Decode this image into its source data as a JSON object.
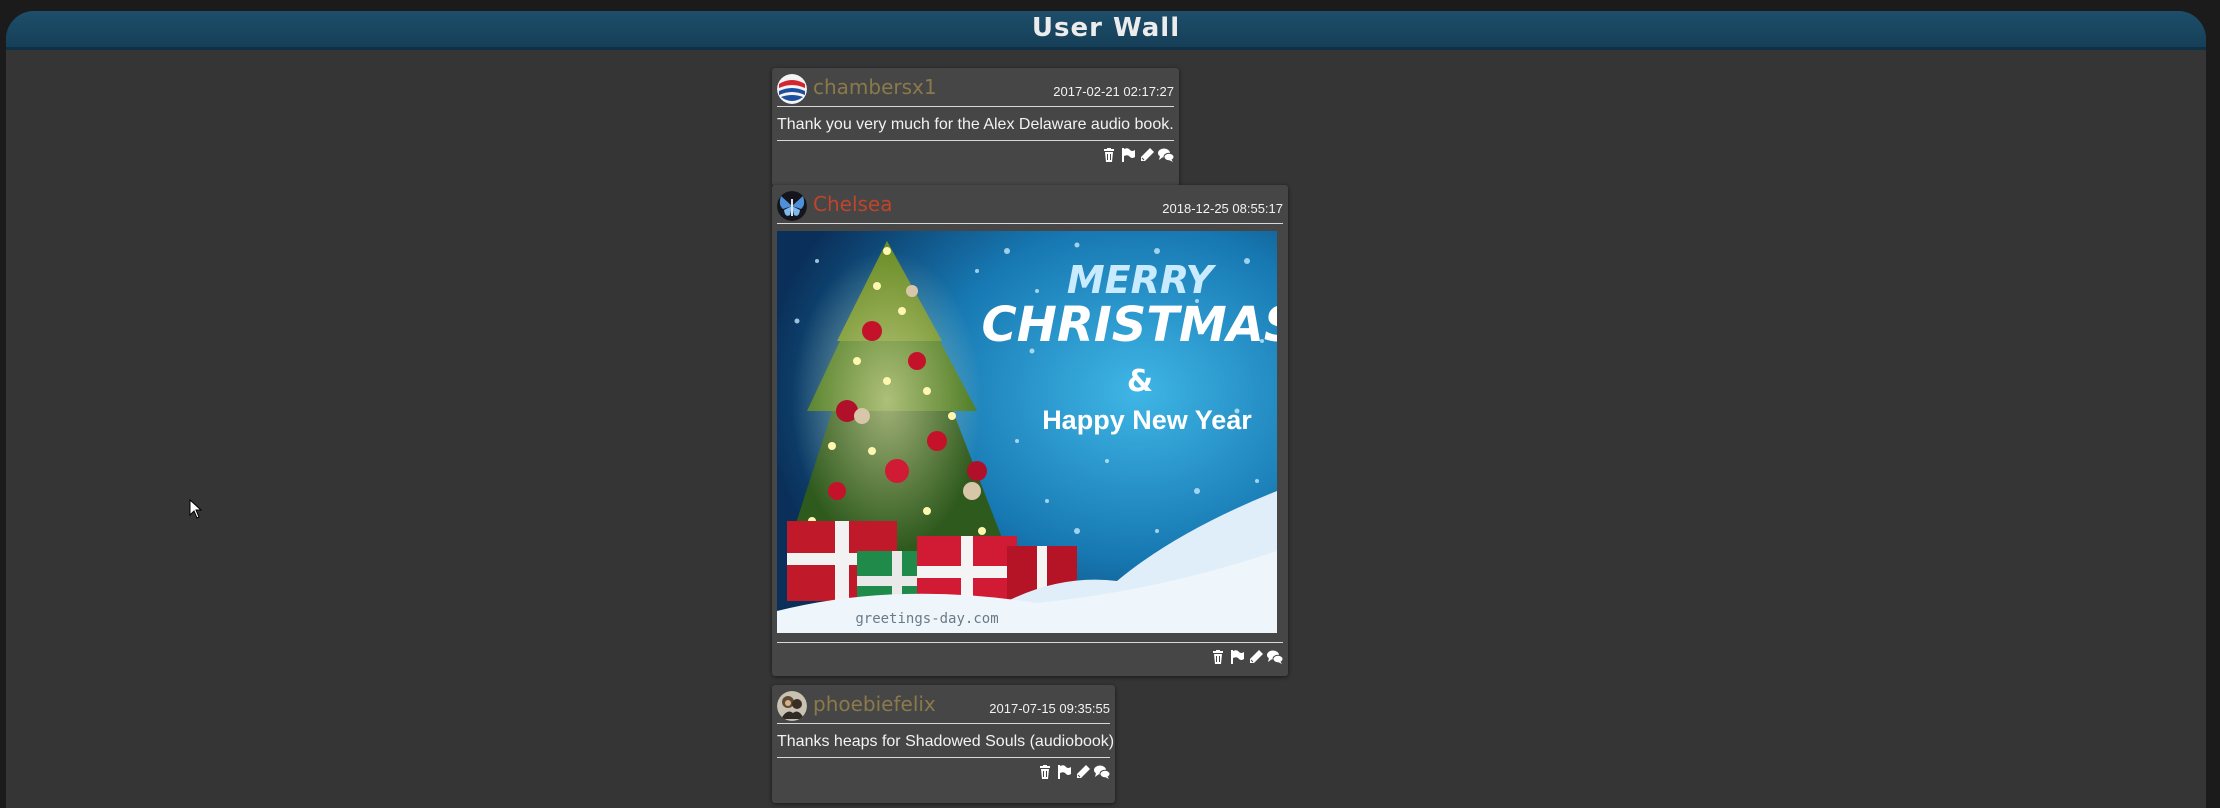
{
  "page": {
    "title": "User Wall"
  },
  "posts": [
    {
      "username": "chambersx1",
      "username_color": "#8a7a4a",
      "timestamp": "2017-02-21 02:17:27",
      "text": "Thank you very much for the Alex Delaware audio book."
    },
    {
      "username": "Chelsea",
      "username_color": "#c0442a",
      "timestamp": "2018-12-25 08:55:17",
      "image": {
        "line1": "MERRY",
        "line2": "CHRISTMAS",
        "line3": "&",
        "line4": "Happy New Year",
        "watermark": "greetings-day.com"
      }
    },
    {
      "username": "phoebiefelix",
      "username_color": "#8a7a4a",
      "timestamp": "2017-07-15 09:35:55",
      "text": "Thanks heaps for Shadowed Souls (audiobook)"
    }
  ],
  "actions": {
    "icons": [
      "trash-icon",
      "flag-icon",
      "pencil-icon",
      "comments-icon"
    ]
  }
}
